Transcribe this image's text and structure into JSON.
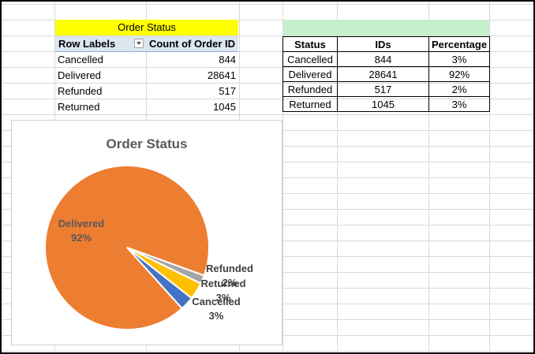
{
  "pivot": {
    "title": "Order Status",
    "col_row_labels": "Row Labels",
    "col_count": "Count of Order ID",
    "rows": [
      {
        "label": "Cancelled",
        "count": "844"
      },
      {
        "label": "Delivered",
        "count": "28641"
      },
      {
        "label": "Refunded",
        "count": "517"
      },
      {
        "label": "Returned",
        "count": "1045"
      }
    ]
  },
  "summary": {
    "headers": [
      "Status",
      "IDs",
      "Percentage"
    ],
    "rows": [
      [
        "Cancelled",
        "844",
        "3%"
      ],
      [
        "Delivered",
        "28641",
        "92%"
      ],
      [
        "Refunded",
        "517",
        "2%"
      ],
      [
        "Returned",
        "1045",
        "3%"
      ]
    ]
  },
  "chart_data": {
    "type": "pie",
    "title": "Order Status",
    "categories": [
      "Delivered",
      "Refunded",
      "Returned",
      "Cancelled"
    ],
    "values": [
      28641,
      517,
      1045,
      844
    ],
    "labels": [
      "92%",
      "2%",
      "3%",
      "3%"
    ],
    "colors": [
      "#ed7d31",
      "#a5a5a5",
      "#ffc000",
      "#4472c4"
    ]
  }
}
